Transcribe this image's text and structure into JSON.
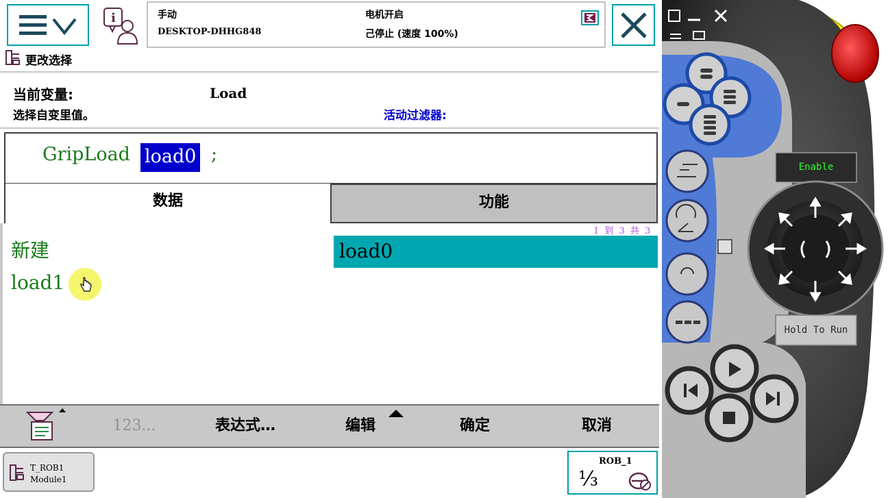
{
  "header": {
    "mode": "手动",
    "controller_name": "DESKTOP-DHHG848",
    "motor_status": "电机开启",
    "run_status": "己停止 (速度 100%)"
  },
  "breadcrumb": {
    "label": "更改选择"
  },
  "info": {
    "current_variable_label": "当前变量:",
    "current_variable_value": "Load",
    "instruction_text": "选择自变里值。",
    "active_filter_label": "活动过滤器:"
  },
  "code": {
    "instruction": "GripLoad",
    "argument": "load0",
    "terminator": ";"
  },
  "tabs": {
    "data": "数据",
    "function": "功能"
  },
  "list": {
    "count_text": "1 到 3 共 3",
    "left_items": [
      "新建",
      "load1"
    ],
    "right_items": [
      "load0"
    ]
  },
  "toolbar": {
    "abc_label": "123...",
    "expression_label": "表达式…",
    "edit_label": "编辑",
    "ok_label": "确定",
    "cancel_label": "取消"
  },
  "taskbar": {
    "task_line1": "T_ROB1",
    "task_line2": "Module1",
    "robot_name": "ROB_1",
    "robot_fraction": "⅓"
  },
  "flexpendant": {
    "enable_label": "Enable",
    "hold_to_run_label": "Hold To Run"
  },
  "colors": {
    "accent": "#00a0a8",
    "selection_bg": "#0000cc",
    "list_selected_bg": "#00a7b0",
    "code_green": "#1a7a1a",
    "filter_blue": "#0000cc"
  }
}
